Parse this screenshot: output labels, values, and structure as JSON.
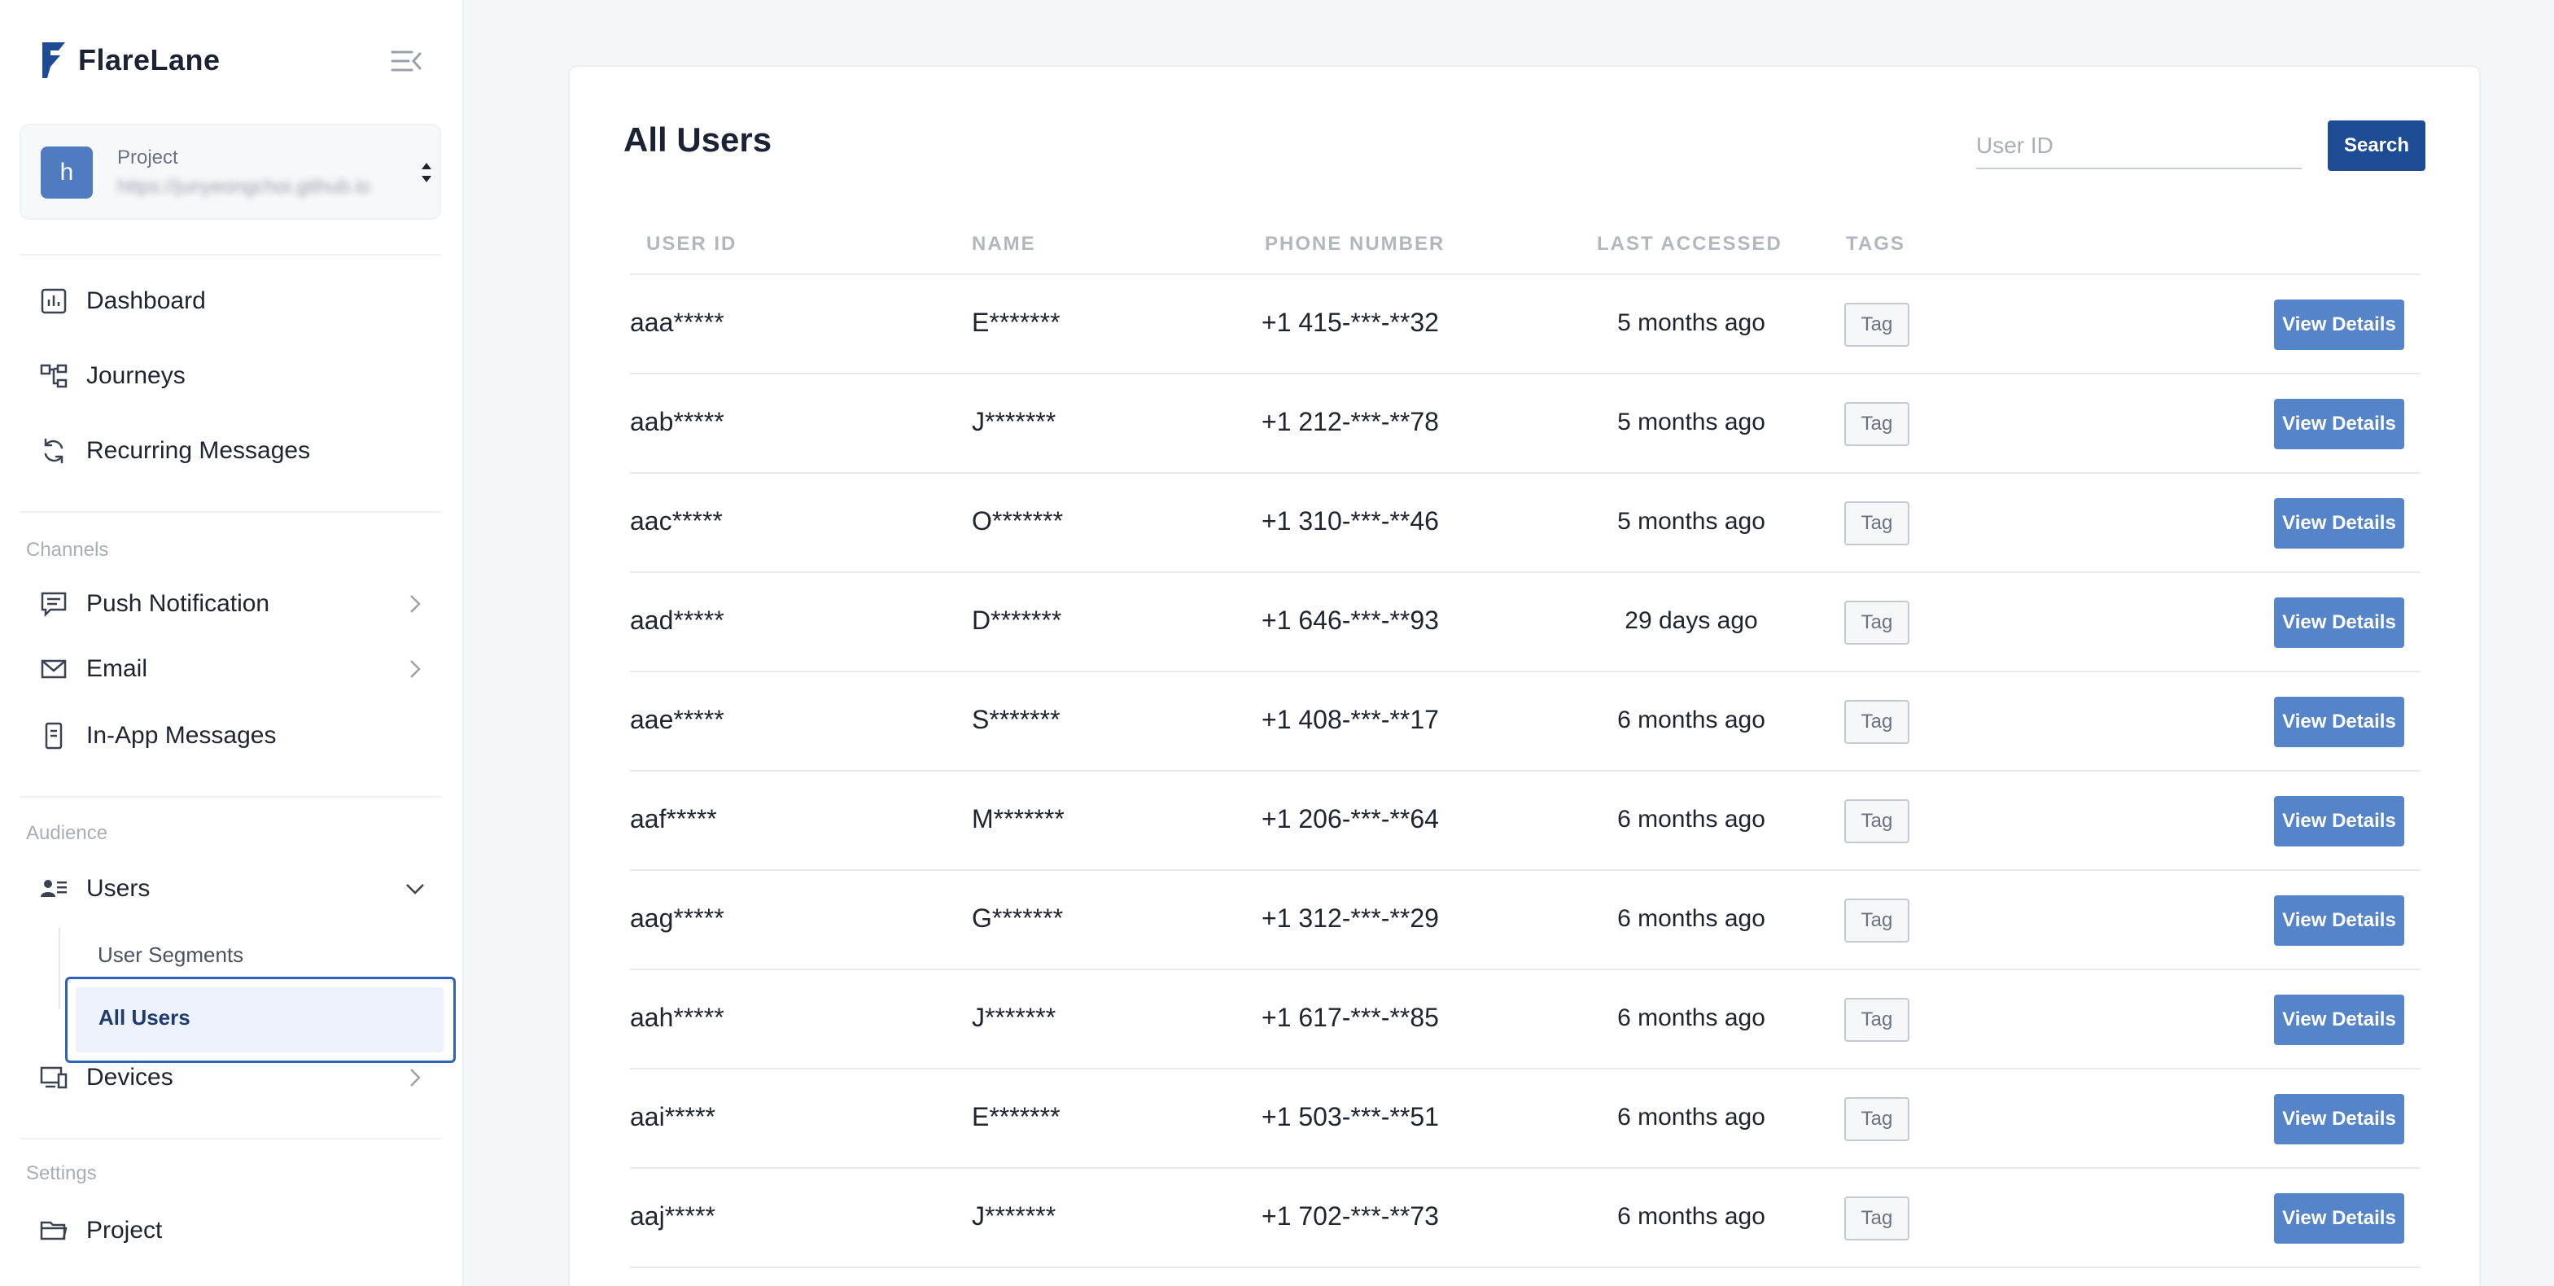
{
  "app": {
    "name": "FlareLane"
  },
  "project": {
    "label": "Project",
    "avatar_letter": "h",
    "url": "https://junyeongchoi.github.io"
  },
  "nav": {
    "top": [
      {
        "label": "Dashboard",
        "icon": "bar-chart-icon"
      },
      {
        "label": "Journeys",
        "icon": "flow-icon"
      },
      {
        "label": "Recurring Messages",
        "icon": "refresh-icon"
      }
    ],
    "channels_title": "Channels",
    "channels": [
      {
        "label": "Push Notification",
        "icon": "message-icon"
      },
      {
        "label": "Email",
        "icon": "mail-icon"
      },
      {
        "label": "In-App Messages",
        "icon": "phone-icon"
      }
    ],
    "audience_title": "Audience",
    "users": {
      "label": "Users",
      "icon": "users-icon"
    },
    "user_segments": "User Segments",
    "all_users": "All Users",
    "devices": {
      "label": "Devices",
      "icon": "devices-icon"
    },
    "settings_title": "Settings",
    "project_nav": {
      "label": "Project",
      "icon": "folder-icon"
    }
  },
  "main": {
    "title": "All Users",
    "search": {
      "placeholder": "User ID",
      "button": "Search"
    },
    "columns": [
      "USER ID",
      "NAME",
      "PHONE NUMBER",
      "LAST ACCESSED",
      "TAGS"
    ],
    "tag_label": "Tag",
    "details_label": "View Details",
    "rows": [
      {
        "user_id": "aaa*****",
        "name": "E*******",
        "phone": "+1 415-***-**32",
        "last": "5 months ago"
      },
      {
        "user_id": "aab*****",
        "name": "J*******",
        "phone": "+1 212-***-**78",
        "last": "5 months ago"
      },
      {
        "user_id": "aac*****",
        "name": "O*******",
        "phone": "+1 310-***-**46",
        "last": "5 months ago"
      },
      {
        "user_id": "aad*****",
        "name": "D*******",
        "phone": "+1 646-***-**93",
        "last": "29 days ago"
      },
      {
        "user_id": "aae*****",
        "name": "S*******",
        "phone": "+1 408-***-**17",
        "last": "6 months ago"
      },
      {
        "user_id": "aaf*****",
        "name": "M*******",
        "phone": "+1 206-***-**64",
        "last": "6 months ago"
      },
      {
        "user_id": "aag*****",
        "name": "G*******",
        "phone": "+1 312-***-**29",
        "last": "6 months ago"
      },
      {
        "user_id": "aah*****",
        "name": "J*******",
        "phone": "+1 617-***-**85",
        "last": "6 months ago"
      },
      {
        "user_id": "aai*****",
        "name": "E*******",
        "phone": "+1 503-***-**51",
        "last": "6 months ago"
      },
      {
        "user_id": "aaj*****",
        "name": "J*******",
        "phone": "+1 702-***-**73",
        "last": "6 months ago"
      }
    ]
  },
  "colors": {
    "accent": "#1e4c94",
    "button": "#5584c8",
    "active_border": "#2f63b8"
  }
}
